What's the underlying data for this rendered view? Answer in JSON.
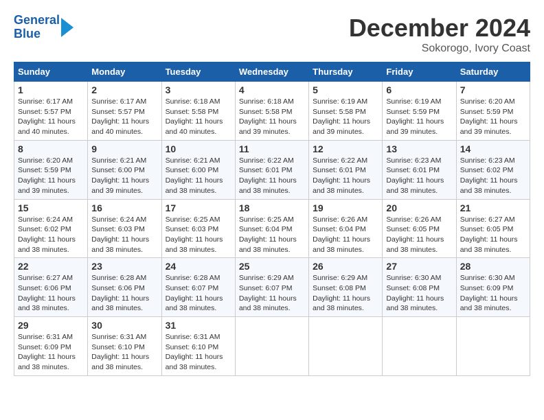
{
  "header": {
    "logo_line1": "General",
    "logo_line2": "Blue",
    "month_title": "December 2024",
    "location": "Sokorogo, Ivory Coast"
  },
  "weekdays": [
    "Sunday",
    "Monday",
    "Tuesday",
    "Wednesday",
    "Thursday",
    "Friday",
    "Saturday"
  ],
  "weeks": [
    [
      {
        "day": "1",
        "sunrise": "6:17 AM",
        "sunset": "5:57 PM",
        "daylight": "11 hours and 40 minutes."
      },
      {
        "day": "2",
        "sunrise": "6:17 AM",
        "sunset": "5:57 PM",
        "daylight": "11 hours and 40 minutes."
      },
      {
        "day": "3",
        "sunrise": "6:18 AM",
        "sunset": "5:58 PM",
        "daylight": "11 hours and 40 minutes."
      },
      {
        "day": "4",
        "sunrise": "6:18 AM",
        "sunset": "5:58 PM",
        "daylight": "11 hours and 39 minutes."
      },
      {
        "day": "5",
        "sunrise": "6:19 AM",
        "sunset": "5:58 PM",
        "daylight": "11 hours and 39 minutes."
      },
      {
        "day": "6",
        "sunrise": "6:19 AM",
        "sunset": "5:59 PM",
        "daylight": "11 hours and 39 minutes."
      },
      {
        "day": "7",
        "sunrise": "6:20 AM",
        "sunset": "5:59 PM",
        "daylight": "11 hours and 39 minutes."
      }
    ],
    [
      {
        "day": "8",
        "sunrise": "6:20 AM",
        "sunset": "5:59 PM",
        "daylight": "11 hours and 39 minutes."
      },
      {
        "day": "9",
        "sunrise": "6:21 AM",
        "sunset": "6:00 PM",
        "daylight": "11 hours and 39 minutes."
      },
      {
        "day": "10",
        "sunrise": "6:21 AM",
        "sunset": "6:00 PM",
        "daylight": "11 hours and 38 minutes."
      },
      {
        "day": "11",
        "sunrise": "6:22 AM",
        "sunset": "6:01 PM",
        "daylight": "11 hours and 38 minutes."
      },
      {
        "day": "12",
        "sunrise": "6:22 AM",
        "sunset": "6:01 PM",
        "daylight": "11 hours and 38 minutes."
      },
      {
        "day": "13",
        "sunrise": "6:23 AM",
        "sunset": "6:01 PM",
        "daylight": "11 hours and 38 minutes."
      },
      {
        "day": "14",
        "sunrise": "6:23 AM",
        "sunset": "6:02 PM",
        "daylight": "11 hours and 38 minutes."
      }
    ],
    [
      {
        "day": "15",
        "sunrise": "6:24 AM",
        "sunset": "6:02 PM",
        "daylight": "11 hours and 38 minutes."
      },
      {
        "day": "16",
        "sunrise": "6:24 AM",
        "sunset": "6:03 PM",
        "daylight": "11 hours and 38 minutes."
      },
      {
        "day": "17",
        "sunrise": "6:25 AM",
        "sunset": "6:03 PM",
        "daylight": "11 hours and 38 minutes."
      },
      {
        "day": "18",
        "sunrise": "6:25 AM",
        "sunset": "6:04 PM",
        "daylight": "11 hours and 38 minutes."
      },
      {
        "day": "19",
        "sunrise": "6:26 AM",
        "sunset": "6:04 PM",
        "daylight": "11 hours and 38 minutes."
      },
      {
        "day": "20",
        "sunrise": "6:26 AM",
        "sunset": "6:05 PM",
        "daylight": "11 hours and 38 minutes."
      },
      {
        "day": "21",
        "sunrise": "6:27 AM",
        "sunset": "6:05 PM",
        "daylight": "11 hours and 38 minutes."
      }
    ],
    [
      {
        "day": "22",
        "sunrise": "6:27 AM",
        "sunset": "6:06 PM",
        "daylight": "11 hours and 38 minutes."
      },
      {
        "day": "23",
        "sunrise": "6:28 AM",
        "sunset": "6:06 PM",
        "daylight": "11 hours and 38 minutes."
      },
      {
        "day": "24",
        "sunrise": "6:28 AM",
        "sunset": "6:07 PM",
        "daylight": "11 hours and 38 minutes."
      },
      {
        "day": "25",
        "sunrise": "6:29 AM",
        "sunset": "6:07 PM",
        "daylight": "11 hours and 38 minutes."
      },
      {
        "day": "26",
        "sunrise": "6:29 AM",
        "sunset": "6:08 PM",
        "daylight": "11 hours and 38 minutes."
      },
      {
        "day": "27",
        "sunrise": "6:30 AM",
        "sunset": "6:08 PM",
        "daylight": "11 hours and 38 minutes."
      },
      {
        "day": "28",
        "sunrise": "6:30 AM",
        "sunset": "6:09 PM",
        "daylight": "11 hours and 38 minutes."
      }
    ],
    [
      {
        "day": "29",
        "sunrise": "6:31 AM",
        "sunset": "6:09 PM",
        "daylight": "11 hours and 38 minutes."
      },
      {
        "day": "30",
        "sunrise": "6:31 AM",
        "sunset": "6:10 PM",
        "daylight": "11 hours and 38 minutes."
      },
      {
        "day": "31",
        "sunrise": "6:31 AM",
        "sunset": "6:10 PM",
        "daylight": "11 hours and 38 minutes."
      },
      null,
      null,
      null,
      null
    ]
  ]
}
